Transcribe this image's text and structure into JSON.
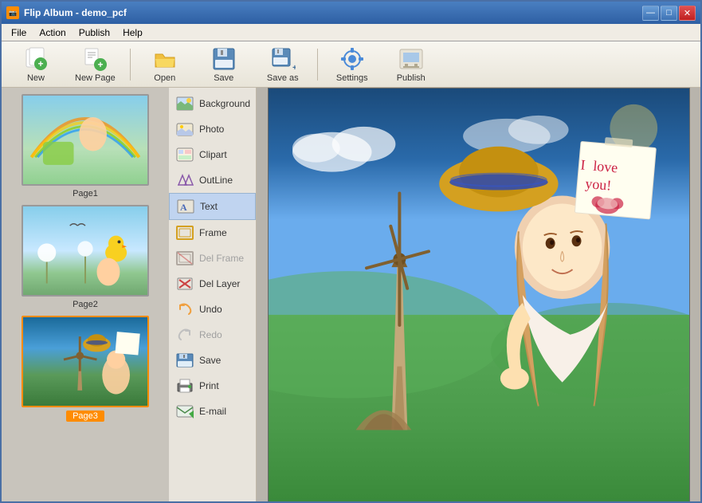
{
  "window": {
    "title": "Flip Album - demo_pcf",
    "controls": {
      "minimize": "—",
      "maximize": "□",
      "close": "✕"
    }
  },
  "menu": {
    "items": [
      "File",
      "Action",
      "Publish",
      "Help"
    ]
  },
  "toolbar": {
    "buttons": [
      {
        "id": "new",
        "label": "New",
        "icon": "new-icon"
      },
      {
        "id": "new-page",
        "label": "New Page",
        "icon": "new-page-icon"
      },
      {
        "id": "open",
        "label": "Open",
        "icon": "open-icon"
      },
      {
        "id": "save",
        "label": "Save",
        "icon": "save-icon"
      },
      {
        "id": "save-as",
        "label": "Save as",
        "icon": "save-as-icon"
      },
      {
        "id": "settings",
        "label": "Settings",
        "icon": "settings-icon"
      },
      {
        "id": "publish",
        "label": "Publish",
        "icon": "publish-icon"
      }
    ]
  },
  "tools": {
    "items": [
      {
        "id": "background",
        "label": "Background",
        "active": false,
        "disabled": false
      },
      {
        "id": "photo",
        "label": "Photo",
        "active": false,
        "disabled": false
      },
      {
        "id": "clipart",
        "label": "Clipart",
        "active": false,
        "disabled": false
      },
      {
        "id": "outline",
        "label": "OutLine",
        "active": false,
        "disabled": false
      },
      {
        "id": "text",
        "label": "Text",
        "active": true,
        "disabled": false
      },
      {
        "id": "frame",
        "label": "Frame",
        "active": false,
        "disabled": false
      },
      {
        "id": "del-frame",
        "label": "Del Frame",
        "active": false,
        "disabled": true
      },
      {
        "id": "del-layer",
        "label": "Del Layer",
        "active": false,
        "disabled": false
      },
      {
        "id": "undo",
        "label": "Undo",
        "active": false,
        "disabled": false
      },
      {
        "id": "redo",
        "label": "Redo",
        "active": false,
        "disabled": true
      },
      {
        "id": "save",
        "label": "Save",
        "active": false,
        "disabled": false
      },
      {
        "id": "print",
        "label": "Print",
        "active": false,
        "disabled": false
      },
      {
        "id": "email",
        "label": "E-mail",
        "active": false,
        "disabled": false
      }
    ]
  },
  "pages": {
    "items": [
      {
        "id": "page1",
        "label": "Page1",
        "active": false
      },
      {
        "id": "page2",
        "label": "Page2",
        "active": false
      },
      {
        "id": "page3",
        "label": "Page3",
        "active": true
      }
    ]
  },
  "canvas": {
    "note_text": "I love you!",
    "colors": {
      "sky_top": "#1a6a9a",
      "sky_mid": "#4a9fd8",
      "grass": "#4a8a4a",
      "accent_orange": "#ff8c00"
    }
  }
}
